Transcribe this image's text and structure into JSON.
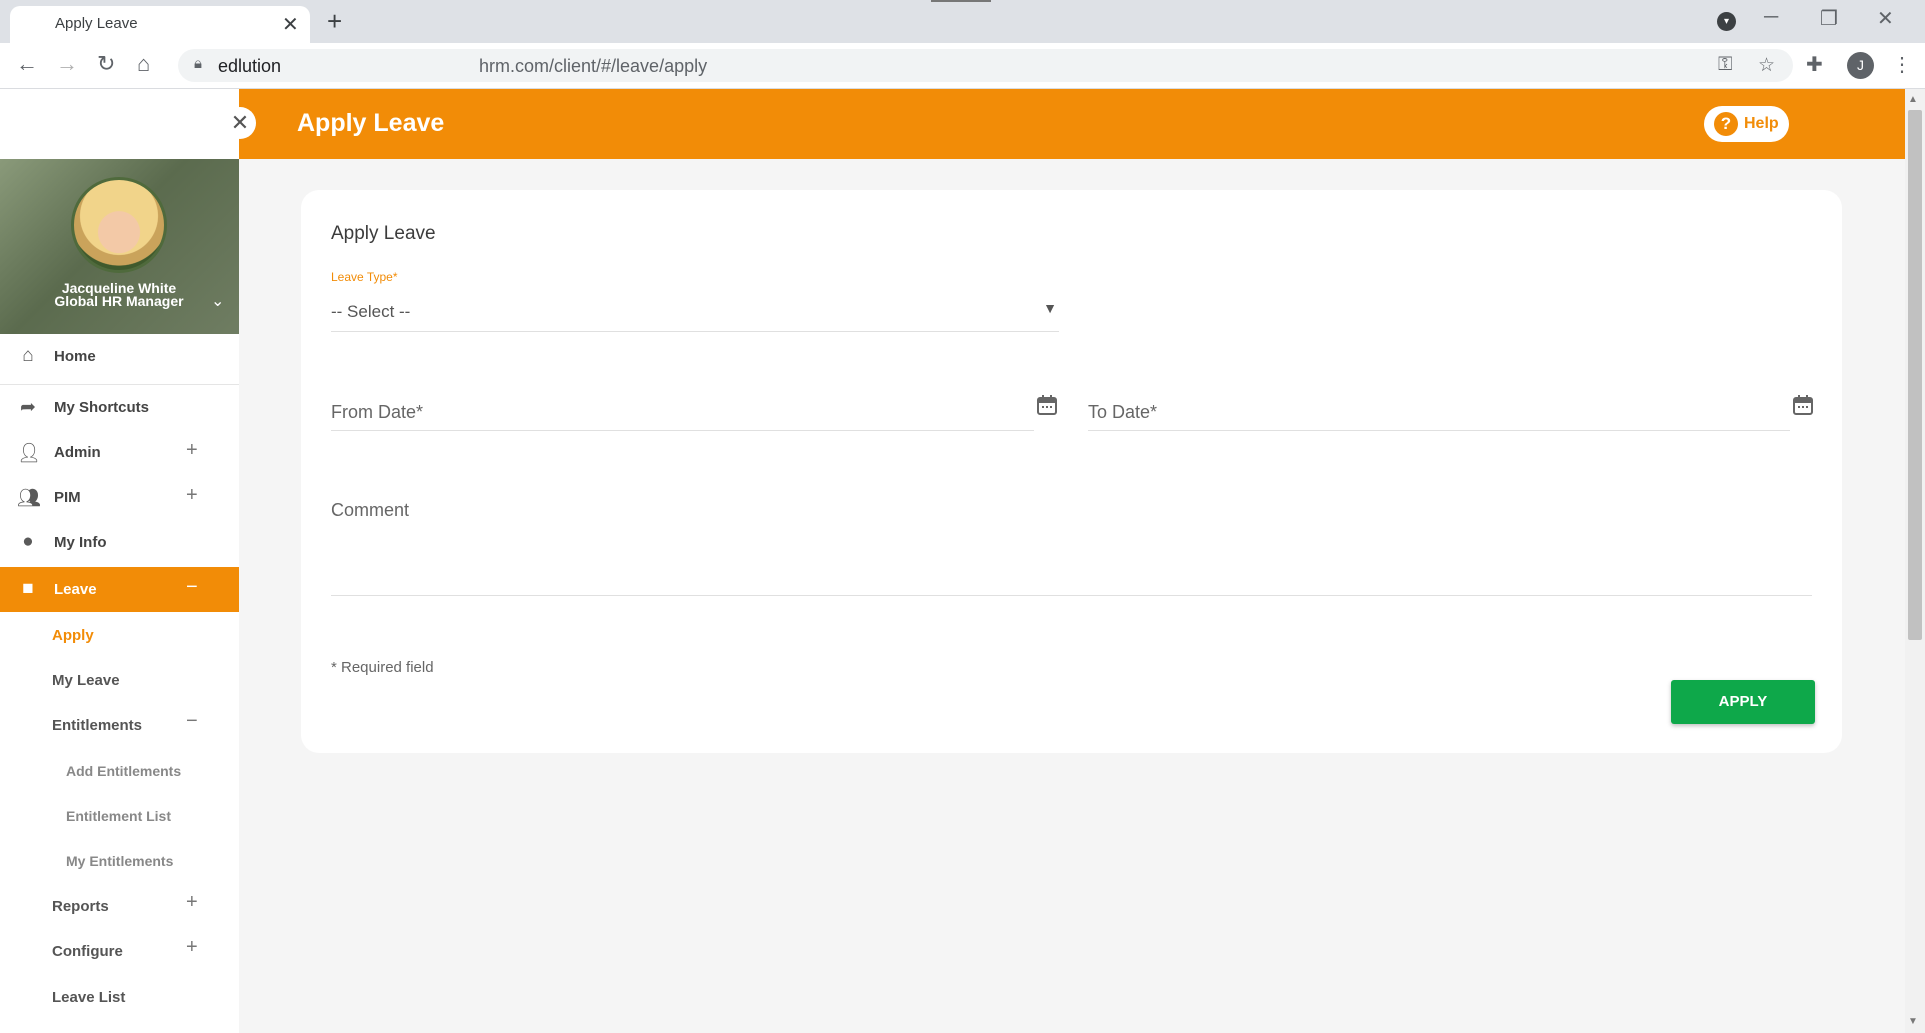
{
  "browser": {
    "tab_title": "Apply Leave",
    "url_host": "edlution",
    "url_path": "hrm.com/client/#/leave/apply",
    "profile_initial": "J",
    "new_tab_symbol": "+",
    "tab_close_symbol": "✕"
  },
  "header": {
    "title": "Apply Leave",
    "help_label": "Help",
    "help_symbol": "?",
    "collapse_symbol": "✕",
    "accent_color": "#f28c07"
  },
  "profile": {
    "name": "Jacqueline White",
    "role": "Global HR Manager"
  },
  "sidebar": {
    "items": [
      {
        "label": "Home",
        "icon": "home-icon"
      },
      {
        "label": "My Shortcuts",
        "icon": "share-arrow-icon"
      },
      {
        "label": "Admin",
        "icon": "user-gear-icon",
        "toggle": "+"
      },
      {
        "label": "PIM",
        "icon": "user-list-icon",
        "toggle": "+"
      },
      {
        "label": "My Info",
        "icon": "user-circle-icon"
      },
      {
        "label": "Leave",
        "icon": "briefcase-icon",
        "toggle": "−"
      }
    ],
    "leave_sub": {
      "apply": "Apply",
      "my_leave": "My Leave",
      "entitlements": "Entitlements",
      "entitlements_toggle": "−",
      "add_entitlements": "Add Entitlements",
      "entitlement_list": "Entitlement List",
      "my_entitlements": "My Entitlements",
      "reports": "Reports",
      "reports_toggle": "+",
      "configure": "Configure",
      "configure_toggle": "+",
      "leave_list": "Leave List"
    }
  },
  "form": {
    "card_title": "Apply Leave",
    "leave_type_label": "Leave Type*",
    "leave_type_value": "-- Select --",
    "from_date_label": "From Date*",
    "to_date_label": "To Date*",
    "comment_label": "Comment",
    "required_note": "* Required field",
    "apply_label": "APPLY",
    "apply_color": "#0ea84a"
  }
}
